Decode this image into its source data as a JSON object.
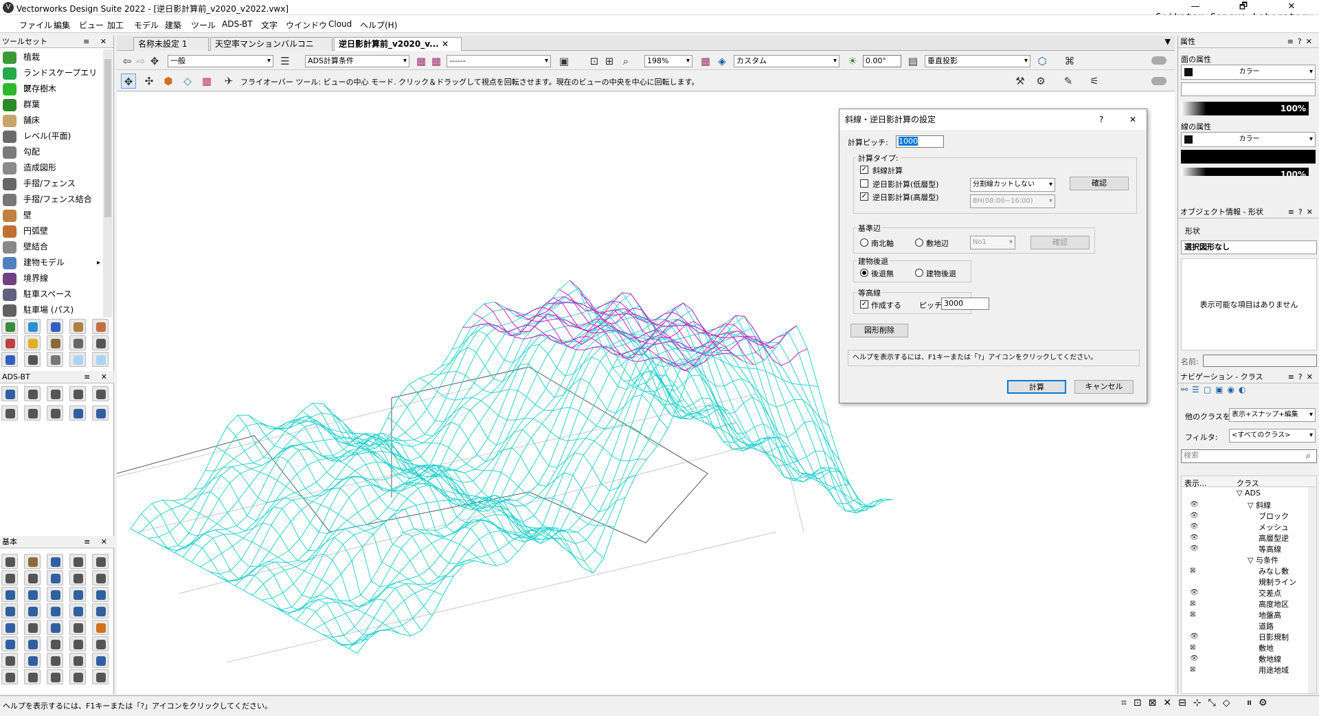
{
  "window": {
    "title": "Vectorworks Design Suite 2022 - [逆日影計算前_v2020_v2022.vwx]",
    "brand": "Seikatsu Sangyo Laboratory",
    "min": "—",
    "max": "🗗",
    "close": "✕"
  },
  "menu": [
    "ファイル",
    "編集",
    "ビュー",
    "加工",
    "モデル",
    "建築",
    "ツール",
    "ADS-BT",
    "文字",
    "ウインドウ",
    "Cloud",
    "ヘルプ(H)"
  ],
  "toolset": {
    "header": "ツールセット",
    "items": [
      "植栽",
      "ランドスケープエリア",
      "既存樹木",
      "群葉",
      "舗床",
      "レベル(平面)",
      "勾配",
      "造成図形",
      "手摺/フェンス",
      "手摺/フェンス結合",
      "壁",
      "円弧壁",
      "壁結合",
      "建物モデル",
      "境界線",
      "駐車スペース",
      "駐車場 (パス)"
    ],
    "colors": [
      "#3a9a3a",
      "#27a84a",
      "#2db82d",
      "#2a8a2a",
      "#c9a46a",
      "#6a6a6a",
      "#7a7a7a",
      "#8a8a8a",
      "#666",
      "#777",
      "#c08040",
      "#c07030",
      "#888",
      "#5080c0",
      "#704080",
      "#606080",
      "#606060"
    ]
  },
  "adsbt": {
    "header": "ADS-BT"
  },
  "basic": {
    "header": "基本"
  },
  "tabs": [
    "名称未設定 1",
    "天空率マンションバルコニー.vwx",
    "逆日影計算前_v2020_v..."
  ],
  "toolbar1": {
    "class": "一般",
    "layer": "ADS計算条件",
    "lineStyle": "------",
    "zoom": "198%",
    "render": "カスタム",
    "angle": "0.00°",
    "projection": "垂直投影"
  },
  "toolbar2": {
    "message": "フライオーバー ツール: ビューの中心 モード. クリック＆ドラッグして視点を回転させます。現在のビューの中央を中心に回転します。"
  },
  "dialog": {
    "title": "斜線・逆日影計算の設定",
    "help": "?",
    "close": "✕",
    "pitchLabel": "計算ピッチ:",
    "pitchValue": "1000",
    "calcType": "計算タイプ:",
    "c1": "斜線計算",
    "c2": "逆日影計算(低層型)",
    "c3": "逆日影計算(高層型)",
    "split": "分割線カットしない",
    "hours": "8H(08:00−16:00)",
    "confirm": "確認",
    "baseEdge": "基準辺",
    "r1": "南北軸",
    "r2": "敷地辺",
    "no": "No1",
    "confirm2": "確認",
    "setback": "建物後退",
    "s1": "後退無",
    "s2": "建物後退",
    "contour": "等高線",
    "contourChk": "作成する",
    "pitch2": "ピッチ",
    "pitch2Value": "3000",
    "deleteBtn": "図形削除",
    "helpMsg": "ヘルプを表示するには、F1キーまたは「?」アイコンをクリックしてください。",
    "ok": "計算",
    "cancel": "キャンセル"
  },
  "attributes": {
    "header": "属性",
    "fill": "面の属性",
    "fillType": "カラー",
    "fillPct": "100%",
    "line": "線の属性",
    "lineType": "カラー",
    "linePct": "100%"
  },
  "objinfo": {
    "header": "オブジェクト情報 - 形状",
    "tab": "形状",
    "none": "選択図形なし",
    "empty": "表示可能な項目はありません",
    "nameLabel": "名前:"
  },
  "nav": {
    "header": "ナビゲーション - クラス",
    "otherClasses": "他のクラスを:",
    "otherValue": "表示+スナップ+編集",
    "filter": "フィルタ:",
    "filterValue": "<すべてのクラス>",
    "search": "検索",
    "colVis": "表示...",
    "colClass": "クラス",
    "rows": [
      {
        "t": "▽ ADS",
        "i": 0
      },
      {
        "t": "▽ 斜線",
        "i": 1
      },
      {
        "t": "ブロック",
        "i": 2
      },
      {
        "t": "メッシュ",
        "i": 2
      },
      {
        "t": "高層型逆",
        "i": 2
      },
      {
        "t": "等高線",
        "i": 2
      },
      {
        "t": "▽ 与条件",
        "i": 1
      },
      {
        "t": "みなし敷",
        "i": 2
      },
      {
        "t": "規制ライン",
        "i": 2
      },
      {
        "t": "交差点",
        "i": 2
      },
      {
        "t": "高度地区",
        "i": 2
      },
      {
        "t": "地盤高",
        "i": 2
      },
      {
        "t": "道路",
        "i": 2
      },
      {
        "t": "日影規制",
        "i": 2
      },
      {
        "t": "敷地",
        "i": 2
      },
      {
        "t": "敷地線",
        "i": 2
      },
      {
        "t": "用途地域",
        "i": 2
      }
    ],
    "eyes": [
      "",
      "👁",
      "👁",
      "👁",
      "👁",
      "👁",
      "",
      "⊠",
      "",
      "👁",
      "⊠",
      "⊠",
      "",
      "👁",
      "⊠",
      "👁",
      "⊠"
    ]
  },
  "status": {
    "message": "ヘルプを表示するには、F1キーまたは「?」アイコンをクリックしてください。"
  }
}
